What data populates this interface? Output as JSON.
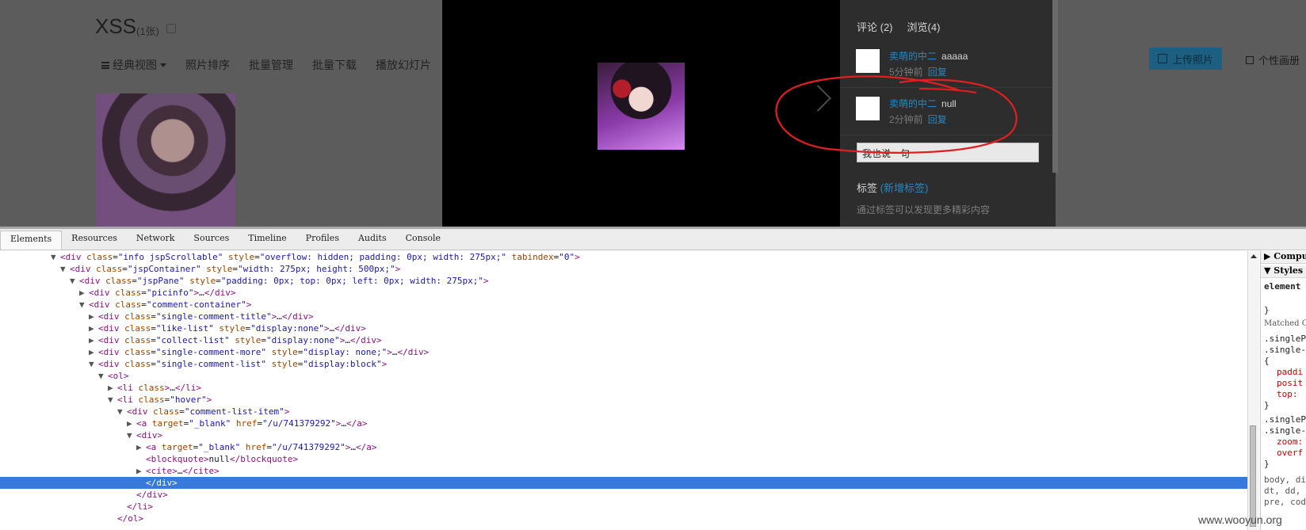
{
  "album": {
    "title": "XSS",
    "count": "(1张)",
    "nav": [
      "经典视图",
      "照片排序",
      "批量管理",
      "批量下载",
      "播放幻灯片"
    ],
    "upload_label": "上传照片",
    "personal_album_label": "个性画册"
  },
  "viewer": {
    "tabs": [
      "评论 (2)",
      "浏览(4)"
    ],
    "comments": [
      {
        "user": "卖萌的中二",
        "text": "aaaaa",
        "time": "5分钟前",
        "reply": "回复"
      },
      {
        "user": "卖萌的中二",
        "text": "null",
        "time": "2分钟前",
        "reply": "回复"
      }
    ],
    "input_placeholder": "我也说一句",
    "tags_label": "标签",
    "tags_link": "(新增标签)",
    "tags_hint": "通过标签可以发现更多精彩内容"
  },
  "devtools": {
    "tabs": [
      "Elements",
      "Resources",
      "Network",
      "Sources",
      "Timeline",
      "Profiles",
      "Audits",
      "Console"
    ],
    "active_tab": "Elements",
    "dom_lines": [
      {
        "indent": 5,
        "tw": "▼",
        "html": "<span class=\"tag\">&lt;div</span> <span class=\"attr\">class</span>=<span class=\"val\">\"info jspScrollable\"</span> <span class=\"attr\">style</span>=<span class=\"val\">\"overflow: hidden; padding: 0px; width: 275px;\"</span> <span class=\"attr\">tabindex</span>=<span class=\"val\">\"0\"</span><span class=\"tag\">&gt;</span>"
      },
      {
        "indent": 6,
        "tw": "▼",
        "html": "<span class=\"tag\">&lt;div</span> <span class=\"attr\">class</span>=<span class=\"val\">\"jspContainer\"</span> <span class=\"attr\">style</span>=<span class=\"val\">\"width: 275px; height: 500px;\"</span><span class=\"tag\">&gt;</span>"
      },
      {
        "indent": 7,
        "tw": "▼",
        "html": "<span class=\"tag\">&lt;div</span> <span class=\"attr\">class</span>=<span class=\"val\">\"jspPane\"</span> <span class=\"attr\">style</span>=<span class=\"val\">\"padding: 0px; top: 0px; left: 0px; width: 275px;\"</span><span class=\"tag\">&gt;</span>"
      },
      {
        "indent": 8,
        "tw": "▶",
        "html": "<span class=\"tag\">&lt;div</span> <span class=\"attr\">class</span>=<span class=\"val\">\"picinfo\"</span><span class=\"tag\">&gt;</span>…<span class=\"tag\">&lt;/div&gt;</span>"
      },
      {
        "indent": 8,
        "tw": "▼",
        "html": "<span class=\"tag\">&lt;div</span> <span class=\"attr\">class</span>=<span class=\"val\">\"comment-container\"</span><span class=\"tag\">&gt;</span>"
      },
      {
        "indent": 9,
        "tw": "▶",
        "html": "<span class=\"tag\">&lt;div</span> <span class=\"attr\">class</span>=<span class=\"val\">\"single-comment-title\"</span><span class=\"tag\">&gt;</span>…<span class=\"tag\">&lt;/div&gt;</span>"
      },
      {
        "indent": 9,
        "tw": "▶",
        "html": "<span class=\"tag\">&lt;div</span> <span class=\"attr\">class</span>=<span class=\"val\">\"like-list\"</span> <span class=\"attr\">style</span>=<span class=\"val\">\"display:none\"</span><span class=\"tag\">&gt;</span>…<span class=\"tag\">&lt;/div&gt;</span>"
      },
      {
        "indent": 9,
        "tw": "▶",
        "html": "<span class=\"tag\">&lt;div</span> <span class=\"attr\">class</span>=<span class=\"val\">\"collect-list\"</span> <span class=\"attr\">style</span>=<span class=\"val\">\"display:none\"</span><span class=\"tag\">&gt;</span>…<span class=\"tag\">&lt;/div&gt;</span>"
      },
      {
        "indent": 9,
        "tw": "▶",
        "html": "<span class=\"tag\">&lt;div</span> <span class=\"attr\">class</span>=<span class=\"val\">\"single-comment-more\"</span> <span class=\"attr\">style</span>=<span class=\"val\">\"display: none;\"</span><span class=\"tag\">&gt;</span>…<span class=\"tag\">&lt;/div&gt;</span>"
      },
      {
        "indent": 9,
        "tw": "▼",
        "html": "<span class=\"tag\">&lt;div</span> <span class=\"attr\">class</span>=<span class=\"val\">\"single-comment-list\"</span> <span class=\"attr\">style</span>=<span class=\"val\">\"display:block\"</span><span class=\"tag\">&gt;</span>"
      },
      {
        "indent": 10,
        "tw": "▼",
        "html": "<span class=\"tag\">&lt;ol&gt;</span>"
      },
      {
        "indent": 11,
        "tw": "▶",
        "html": "<span class=\"tag\">&lt;li</span> <span class=\"attr\">class</span><span class=\"tag\">&gt;</span>…<span class=\"tag\">&lt;/li&gt;</span>"
      },
      {
        "indent": 11,
        "tw": "▼",
        "html": "<span class=\"tag\">&lt;li</span> <span class=\"attr\">class</span>=<span class=\"val\">\"hover\"</span><span class=\"tag\">&gt;</span>"
      },
      {
        "indent": 12,
        "tw": "▼",
        "html": "<span class=\"tag\">&lt;div</span> <span class=\"attr\">class</span>=<span class=\"val\">\"comment-list-item\"</span><span class=\"tag\">&gt;</span>"
      },
      {
        "indent": 13,
        "tw": "▶",
        "html": "<span class=\"tag\">&lt;a</span> <span class=\"attr\">target</span>=<span class=\"val\">\"_blank\"</span> <span class=\"attr\">href</span>=<span class=\"val\">\"/u/741379292\"</span><span class=\"tag\">&gt;</span>…<span class=\"tag\">&lt;/a&gt;</span>"
      },
      {
        "indent": 13,
        "tw": "▼",
        "html": "<span class=\"tag\">&lt;div&gt;</span>"
      },
      {
        "indent": 14,
        "tw": "▶",
        "html": "<span class=\"tag\">&lt;a</span> <span class=\"attr\">target</span>=<span class=\"val\">\"_blank\"</span> <span class=\"attr\">href</span>=<span class=\"val\">\"/u/741379292\"</span><span class=\"tag\">&gt;</span>…<span class=\"tag\">&lt;/a&gt;</span>"
      },
      {
        "indent": 14,
        "tw": "",
        "html": "<span class=\"tag\">&lt;blockquote&gt;</span>null<span class=\"tag\">&lt;/blockquote&gt;</span>"
      },
      {
        "indent": 14,
        "tw": "▶",
        "html": "<span class=\"tag\">&lt;cite&gt;</span>…<span class=\"tag\">&lt;/cite&gt;</span>"
      },
      {
        "indent": 14,
        "tw": "",
        "html": "<span class=\"tag\">&lt;/div&gt;</span>",
        "selected": true
      },
      {
        "indent": 13,
        "tw": "",
        "html": "<span class=\"tag\">&lt;/div&gt;</span>"
      },
      {
        "indent": 12,
        "tw": "",
        "html": "<span class=\"tag\">&lt;/li&gt;</span>"
      },
      {
        "indent": 11,
        "tw": "",
        "html": "<span class=\"tag\">&lt;/ol&gt;</span>"
      }
    ],
    "side_panel": {
      "computed_label": "▶ Comput",
      "styles_label": "▼ Styles",
      "element_label": "element",
      "brace_close": "}",
      "matched_label": "Matched C",
      "rule1_sel1": ".singleP",
      "rule1_sel2": ".single-",
      "brace_open": "{",
      "rule1_prop1": "paddi",
      "rule1_prop2": "posit",
      "rule1_prop3": "top:",
      "rule2_sel1": ".singleP",
      "rule2_sel2": ".single-",
      "rule2_prop1": "zoom:",
      "rule2_prop2": "overf",
      "inherited1": "body, di",
      "inherited2": "dt, dd,",
      "inherited3": "pre, cod"
    }
  },
  "watermark": "www.wooyun.org"
}
